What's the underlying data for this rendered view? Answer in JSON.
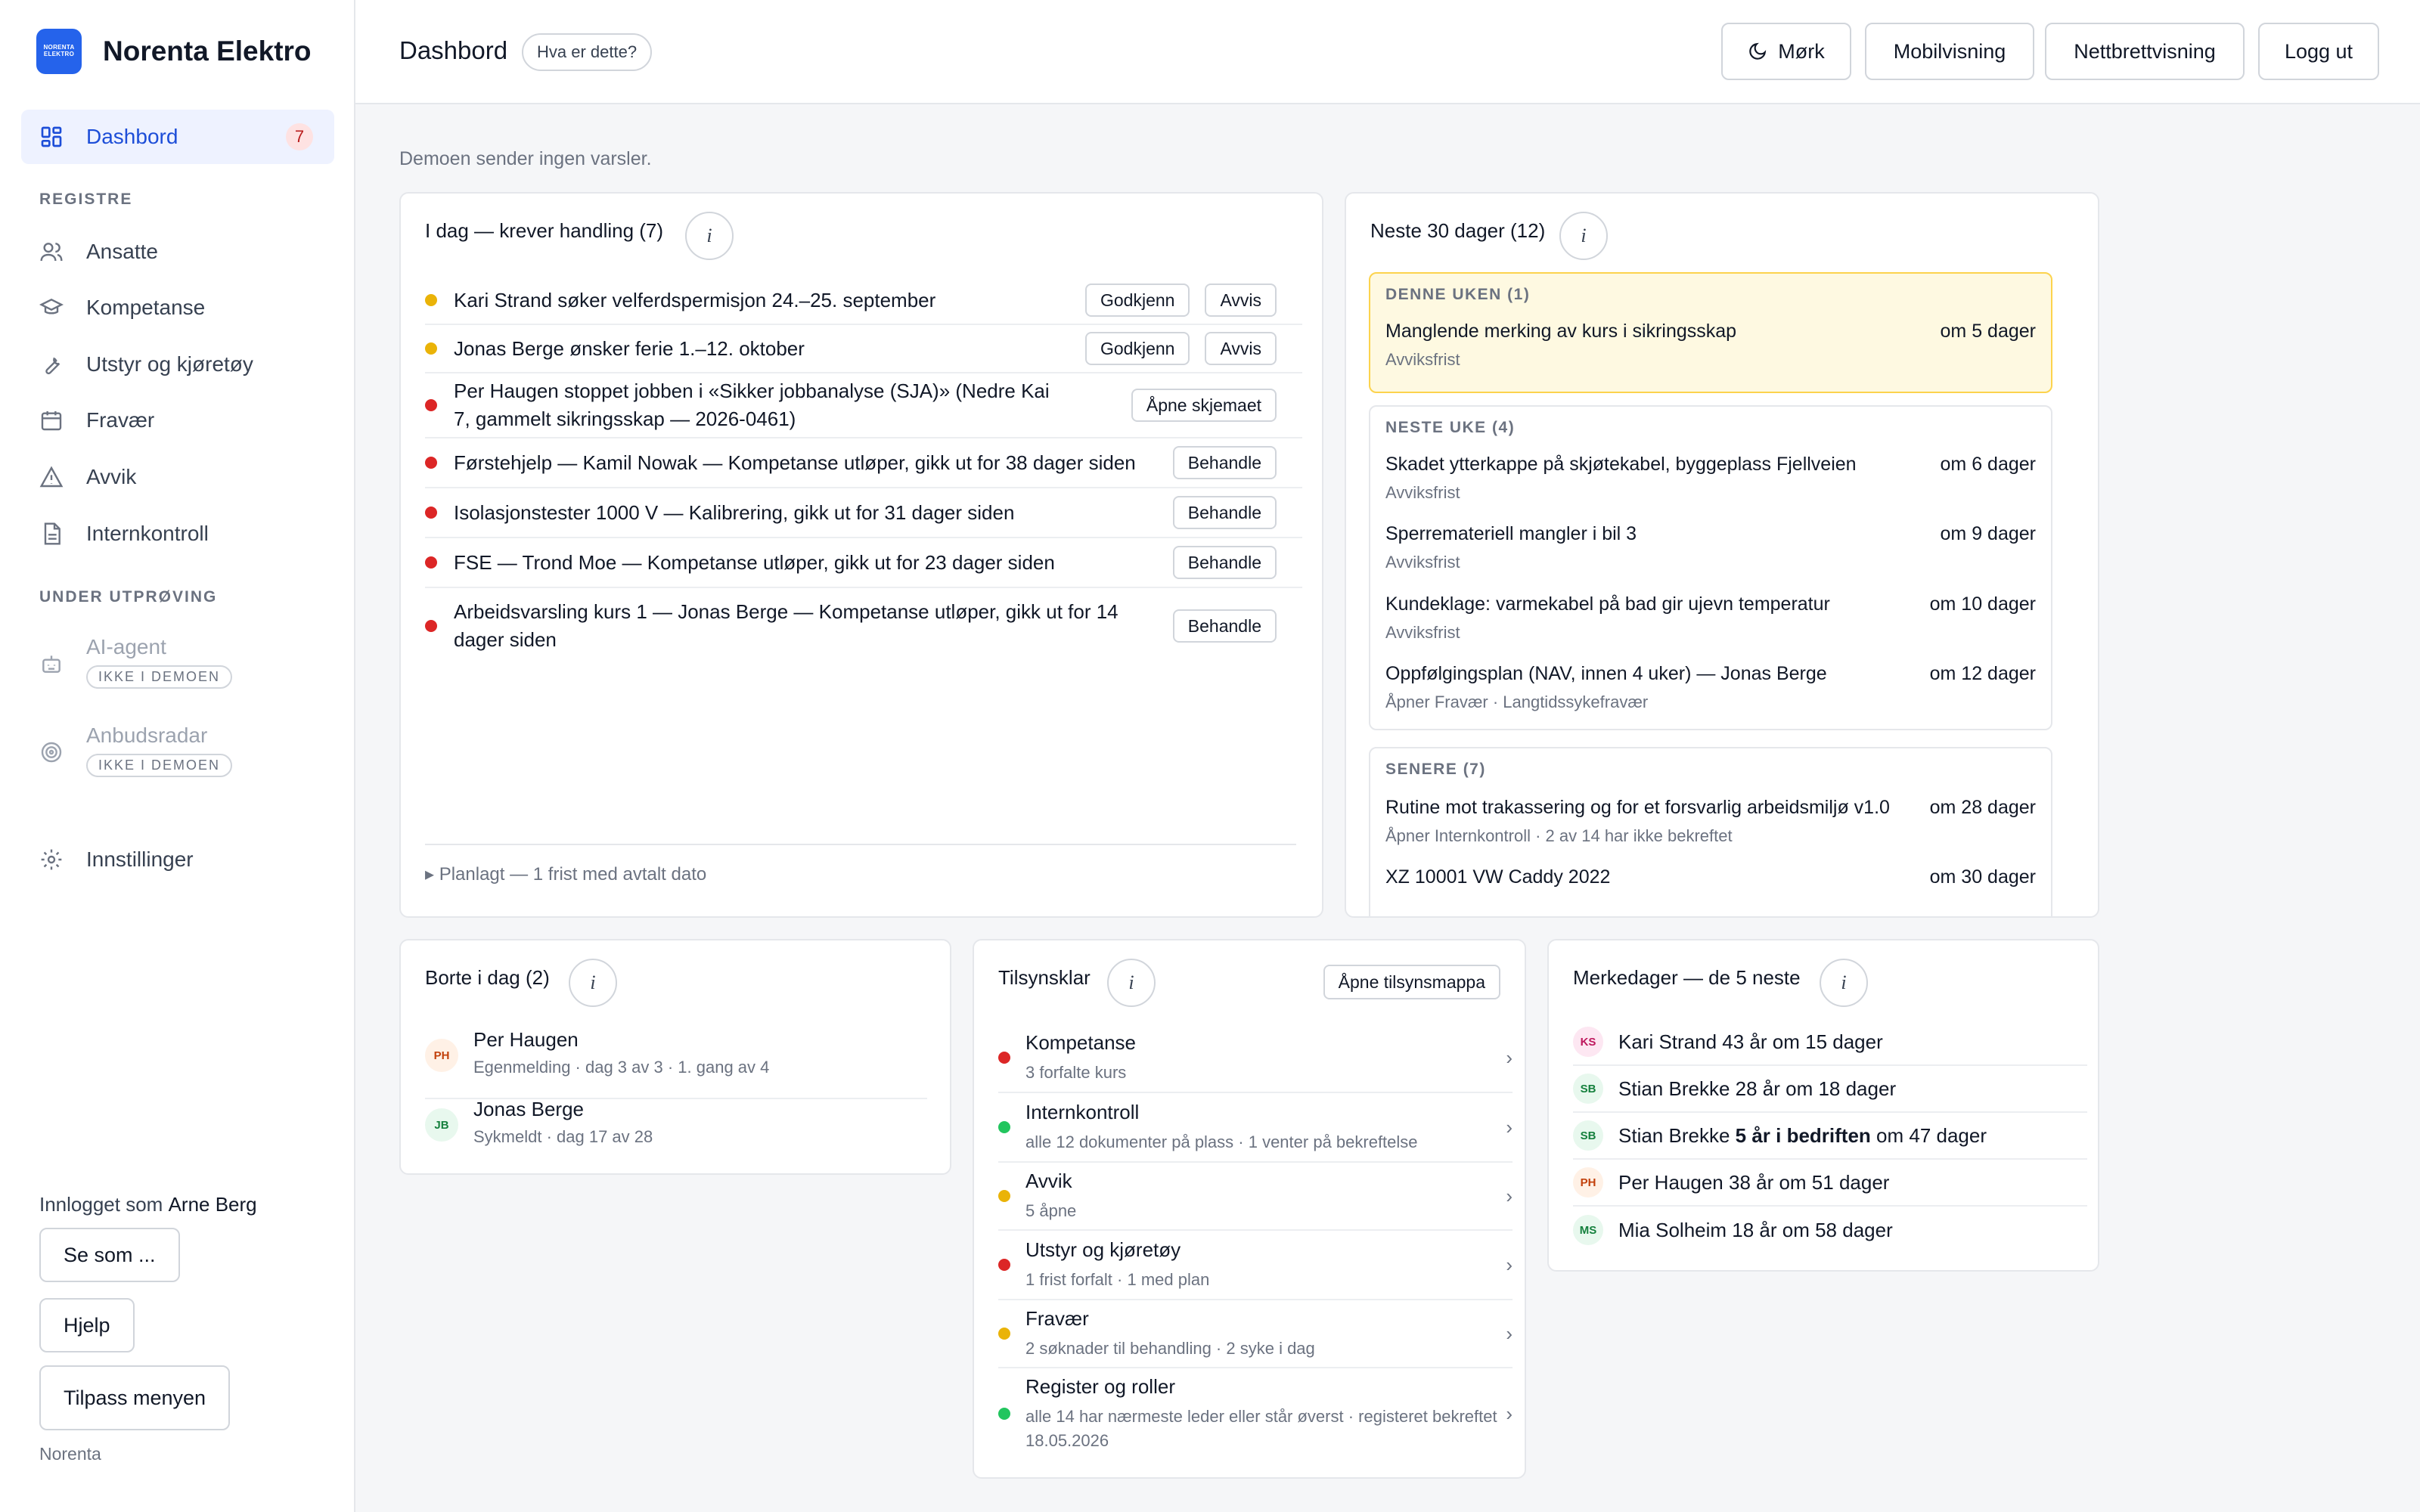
{
  "app": {
    "logo_line1": "NORENTA",
    "logo_line2": "ELEKTRO",
    "name": "Norenta Elektro"
  },
  "nav": {
    "dashboard": {
      "label": "Dashbord",
      "badge": "7"
    },
    "section_registers": "REGISTRE",
    "items": [
      {
        "label": "Ansatte",
        "icon": "users-icon"
      },
      {
        "label": "Kompetanse",
        "icon": "graduation-cap-icon"
      },
      {
        "label": "Utstyr og kjøretøy",
        "icon": "wrench-icon"
      },
      {
        "label": "Fravær",
        "icon": "calendar-icon"
      },
      {
        "label": "Avvik",
        "icon": "warning-triangle-icon"
      },
      {
        "label": "Internkontroll",
        "icon": "document-icon"
      }
    ],
    "section_trial": "UNDER UTPRØVING",
    "trial": [
      {
        "label": "AI-agent",
        "badge": "IKKE I DEMOEN",
        "icon": "robot-icon"
      },
      {
        "label": "Anbudsradar",
        "badge": "IKKE I DEMOEN",
        "icon": "radar-icon"
      }
    ],
    "settings": "Innstillinger"
  },
  "sidebar_footer": {
    "logged_in_prefix": "Innlogget som",
    "user": "Arne Berg",
    "view_as": "Se som ...",
    "help": "Hjelp",
    "customize": "Tilpass menyen",
    "org": "Norenta"
  },
  "header": {
    "title": "Dashbord",
    "help_pill": "Hva er dette?",
    "dark": "Mørk",
    "mobile": "Mobilvisning",
    "tablet": "Nettbrettvisning",
    "logout": "Logg ut"
  },
  "notice": "Demoen sender ingen varsler.",
  "today": {
    "title": "I dag — krever handling (7)",
    "info": "i",
    "tasks": [
      {
        "text": "Kari Strand søker velferdspermisjon 24.–25. september",
        "color": "#eab308",
        "actions": [
          "Godkjenn",
          "Avvis"
        ]
      },
      {
        "text": "Jonas Berge ønsker ferie 1.–12. oktober",
        "color": "#eab308",
        "actions": [
          "Godkjenn",
          "Avvis"
        ]
      },
      {
        "text": "Per Haugen stoppet jobben i «Sikker jobbanalyse (SJA)» (Nedre Kai 7, gammelt sikringsskap — 2026-0461)",
        "color": "#dc2626",
        "actions": [
          "Åpne skjemaet"
        ]
      },
      {
        "text": "Førstehjelp — Kamil Nowak — Kompetanse utløper, gikk ut for 38 dager siden",
        "color": "#dc2626",
        "actions": [
          "Behandle"
        ]
      },
      {
        "text": "Isolasjonstester 1000 V — Kalibrering, gikk ut for 31 dager siden",
        "color": "#dc2626",
        "actions": [
          "Behandle"
        ]
      },
      {
        "text": "FSE — Trond Moe — Kompetanse utløper, gikk ut for 23 dager siden",
        "color": "#dc2626",
        "actions": [
          "Behandle"
        ]
      },
      {
        "text": "Arbeidsvarsling kurs 1 — Jonas Berge — Kompetanse utløper, gikk ut for 14 dager siden",
        "color": "#dc2626",
        "actions": [
          "Behandle"
        ]
      }
    ],
    "planned": "▸  Planlagt — 1 frist med avtalt dato"
  },
  "next30": {
    "title": "Neste 30 dager (12)",
    "info": "i",
    "groups": [
      {
        "title": "DENNE UKEN (1)",
        "items": [
          {
            "text": "Manglende merking av kurs i sikringsskap",
            "when": "om 5 dager",
            "sub": "Avviksfrist"
          }
        ]
      },
      {
        "title": "NESTE UKE (4)",
        "items": [
          {
            "text": "Skadet ytterkappe på skjøtekabel, byggeplass Fjellveien",
            "when": "om 6 dager",
            "sub": "Avviksfrist"
          },
          {
            "text": "Sperremateriell mangler i bil 3",
            "when": "om 9 dager",
            "sub": "Avviksfrist"
          },
          {
            "text": "Kundeklage: varmekabel på bad gir ujevn temperatur",
            "when": "om 10 dager",
            "sub": "Avviksfrist"
          },
          {
            "text": "Oppfølgingsplan (NAV, innen 4 uker) — Jonas Berge",
            "when": "om 12 dager",
            "sub": "Åpner Fravær · Langtidssykefravær"
          }
        ]
      },
      {
        "title": "SENERE (7)",
        "items": [
          {
            "text": "Rutine mot trakassering og for et forsvarlig arbeidsmiljø v1.0",
            "when": "om 28 dager",
            "sub": "Åpner Internkontroll · 2 av 14 har ikke bekreftet"
          },
          {
            "text": "XZ 10001 VW Caddy 2022",
            "when": "om 30 dager",
            "sub": ""
          }
        ]
      }
    ]
  },
  "away": {
    "title": "Borte i dag (2)",
    "info": "i",
    "people": [
      {
        "initials": "PH",
        "name": "Per Haugen",
        "sub": "Egenmelding · dag 3 av 3 · 1. gang av 4"
      },
      {
        "initials": "JB",
        "name": "Jonas Berge",
        "sub": "Sykmeldt · dag 17 av 28"
      }
    ]
  },
  "inspection": {
    "title": "Tilsynsklar",
    "info": "i",
    "open_btn": "Åpne tilsynsmappa",
    "rows": [
      {
        "title": "Kompetanse",
        "sub": "3 forfalte kurs",
        "color": "#dc2626"
      },
      {
        "title": "Internkontroll",
        "sub": "alle 12 dokumenter på plass · 1 venter på bekreftelse",
        "color": "#22c55e"
      },
      {
        "title": "Avvik",
        "sub": "5 åpne",
        "color": "#eab308"
      },
      {
        "title": "Utstyr og kjøretøy",
        "sub": "1 frist forfalt · 1 med plan",
        "color": "#dc2626"
      },
      {
        "title": "Fravær",
        "sub": "2 søknader til behandling · 2 syke i dag",
        "color": "#eab308"
      },
      {
        "title": "Register og roller",
        "sub": "alle 14 har nærmeste leder eller står øverst · registeret bekreftet 18.05.2026",
        "color": "#22c55e"
      }
    ],
    "chevron": "›"
  },
  "birthdays": {
    "title": "Merkedager — de 5 neste",
    "info": "i",
    "rows": [
      {
        "initials": "KS",
        "pre": "Kari Strand 43 år om 15 dager",
        "bold": "",
        "post": ""
      },
      {
        "initials": "SB",
        "pre": "Stian Brekke 28 år om 18 dager",
        "bold": "",
        "post": ""
      },
      {
        "initials": "SB",
        "pre": "Stian Brekke ",
        "bold": "5 år i bedriften",
        "post": " om 47 dager"
      },
      {
        "initials": "PH",
        "pre": "Per Haugen 38 år om 51 dager",
        "bold": "",
        "post": ""
      },
      {
        "initials": "MS",
        "pre": "Mia Solheim 18 år om 58 dager",
        "bold": "",
        "post": ""
      }
    ]
  }
}
